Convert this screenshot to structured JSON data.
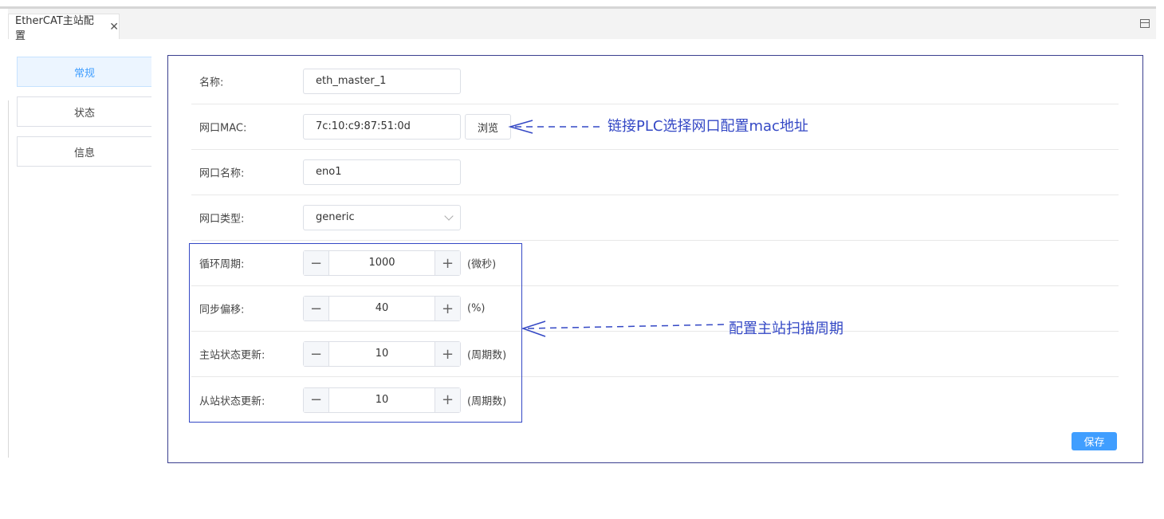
{
  "tab": {
    "title": "EtherCAT主站配置",
    "close": "✕"
  },
  "sidebar": [
    {
      "label": "常规",
      "active": true
    },
    {
      "label": "状态",
      "active": false
    },
    {
      "label": "信息",
      "active": false
    }
  ],
  "form": {
    "name": {
      "label": "名称:",
      "value": "eth_master_1"
    },
    "mac": {
      "label": "网口MAC:",
      "value": "7c:10:c9:87:51:0d",
      "browse": "浏览"
    },
    "ifname": {
      "label": "网口名称:",
      "value": "eno1"
    },
    "iftype": {
      "label": "网口类型:",
      "value": "generic"
    },
    "cycle": {
      "label": "循环周期:",
      "value": "1000",
      "unit": "(微秒)"
    },
    "sync_offset": {
      "label": "同步偏移:",
      "value": "40",
      "unit": "(%)"
    },
    "master_update": {
      "label": "主站状态更新:",
      "value": "10",
      "unit": "(周期数)"
    },
    "slave_update": {
      "label": "从站状态更新:",
      "value": "10",
      "unit": "(周期数)"
    }
  },
  "stepper": {
    "minus": "−",
    "plus": "+"
  },
  "save_label": "保存",
  "annotations": {
    "mac_note": "链接PLC选择网口配置mac地址",
    "cycle_note": "配置主站扫描周期",
    "color": "#3448c5"
  }
}
